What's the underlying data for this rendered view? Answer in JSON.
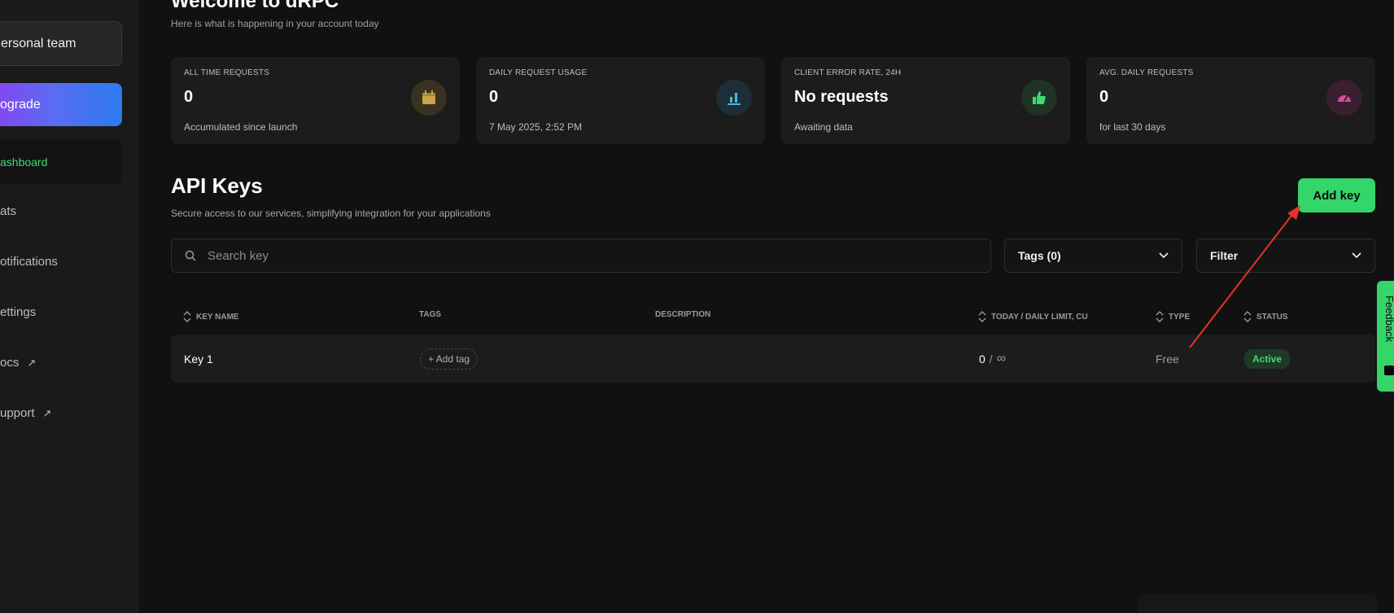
{
  "sidebar": {
    "team_label": "ersonal team",
    "upgrade_label": "ograde",
    "active_item": "ashboard",
    "items": [
      {
        "label": "ats"
      },
      {
        "label": "otifications"
      },
      {
        "label": "ettings"
      },
      {
        "label": "ocs",
        "external": true
      },
      {
        "label": "upport",
        "external": true
      }
    ]
  },
  "header": {
    "title": "Welcome to dRPC",
    "subtitle": "Here is what is happening in your account today"
  },
  "stats": [
    {
      "title": "ALL TIME REQUESTS",
      "value": "0",
      "sub": "Accumulated since launch",
      "icon": "calendar-icon",
      "icon_color": "#c9a54a",
      "icon_bg": "#3a3220"
    },
    {
      "title": "DAILY REQUEST USAGE",
      "value": "0",
      "sub": "7 May 2025, 2:52 PM",
      "icon": "bar-chart-icon",
      "icon_color": "#4ab8e0",
      "icon_bg": "#1e2e38"
    },
    {
      "title": "CLIENT ERROR RATE, 24H",
      "value": "No requests",
      "sub": "Awaiting data",
      "icon": "thumbs-up-icon",
      "icon_color": "#3ddc6e",
      "icon_bg": "#1e3326"
    },
    {
      "title": "AVG. DAILY REQUESTS",
      "value": "0",
      "sub": "for last 30 days",
      "icon": "gauge-icon",
      "icon_color": "#d94a9a",
      "icon_bg": "#3a1f30"
    }
  ],
  "api_keys": {
    "title": "API Keys",
    "subtitle": "Secure access to our services, simplifying integration for your applications",
    "add_button": "Add key",
    "search_placeholder": "Search key",
    "tags_dropdown": "Tags (0)",
    "filter_dropdown": "Filter",
    "columns": {
      "key_name": "KEY NAME",
      "tags": "TAGS",
      "description": "DESCRIPTION",
      "limit": "TODAY / DAILY LIMIT, CU",
      "type": "TYPE",
      "status": "STATUS"
    },
    "rows": [
      {
        "key_name": "Key 1",
        "add_tag": "+ Add tag",
        "description": "",
        "usage": "0",
        "limit_sep": "/",
        "limit": "∞",
        "type": "Free",
        "status": "Active"
      }
    ]
  },
  "feedback_label": "Feedback",
  "colors": {
    "accent": "#34d66a",
    "background": "#111111",
    "card": "#1c1c1c",
    "annotation_arrow": "#e8322a"
  }
}
